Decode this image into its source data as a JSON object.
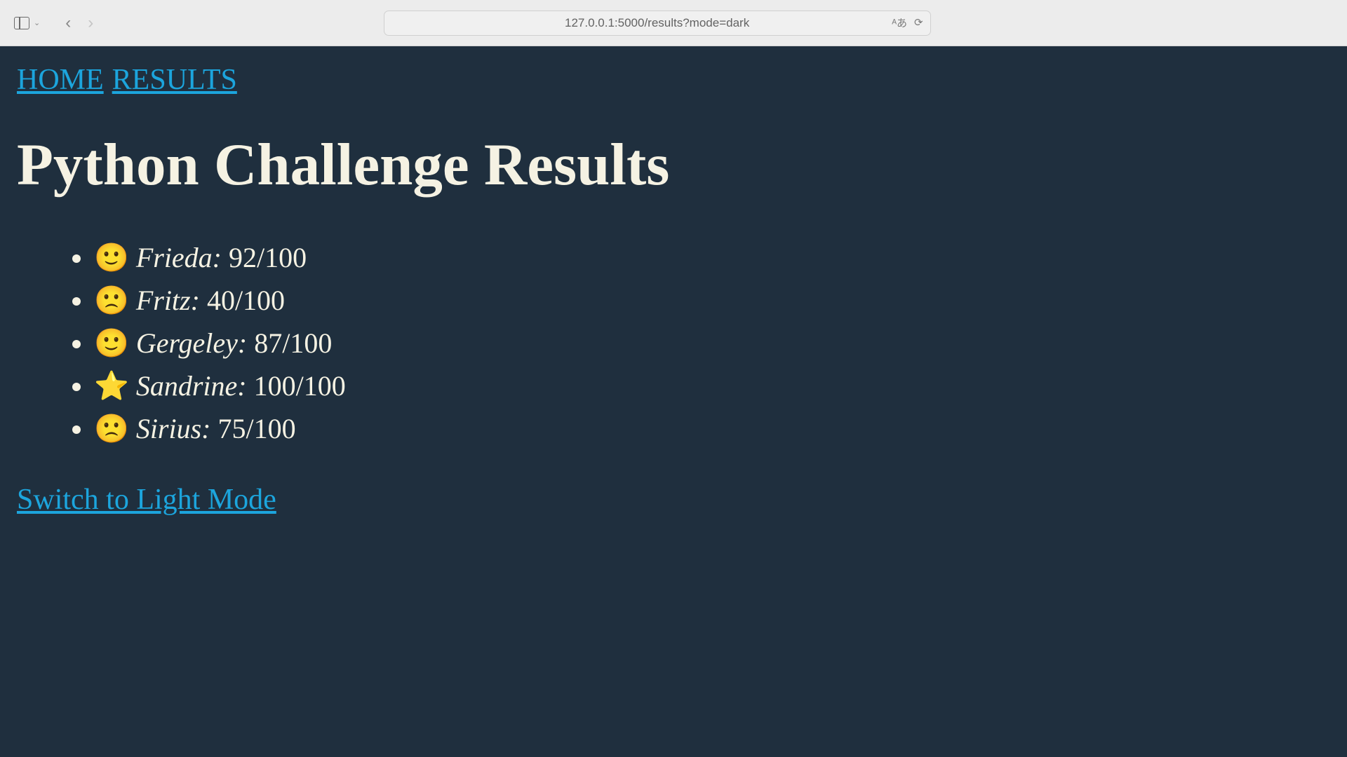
{
  "browser": {
    "url": "127.0.0.1:5000/results?mode=dark"
  },
  "nav": {
    "home_label": "HOME",
    "results_label": "RESULTS"
  },
  "page": {
    "title": "Python Challenge Results"
  },
  "results": [
    {
      "emoji": "🙂",
      "name": "Frieda:",
      "score": "92/100"
    },
    {
      "emoji": "🙁",
      "name": "Fritz:",
      "score": "40/100"
    },
    {
      "emoji": "🙂",
      "name": "Gergeley:",
      "score": "87/100"
    },
    {
      "emoji": "⭐",
      "name": "Sandrine:",
      "score": "100/100"
    },
    {
      "emoji": "🙁",
      "name": "Sirius:",
      "score": "75/100"
    }
  ],
  "mode_switch": {
    "label": "Switch to Light Mode"
  }
}
